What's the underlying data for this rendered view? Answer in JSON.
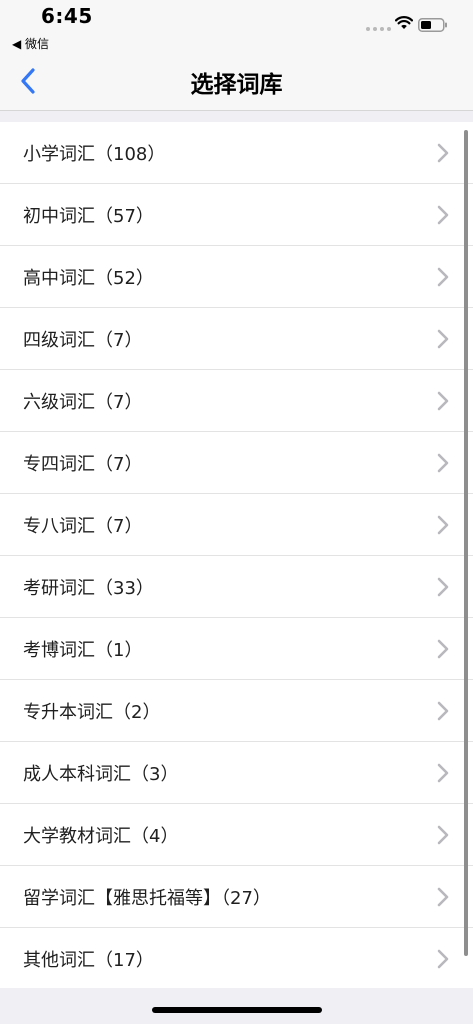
{
  "status_bar": {
    "time": "6:45",
    "back_app": "◀ 微信"
  },
  "nav": {
    "back_icon": "chevron-left-icon",
    "title": "选择词库",
    "accent_color": "#3478f6"
  },
  "list": {
    "items": [
      {
        "label": "小学词汇（108）"
      },
      {
        "label": "初中词汇（57）"
      },
      {
        "label": "高中词汇（52）"
      },
      {
        "label": "四级词汇（7）"
      },
      {
        "label": "六级词汇（7）"
      },
      {
        "label": "专四词汇（7）"
      },
      {
        "label": "专八词汇（7）"
      },
      {
        "label": "考研词汇（33）"
      },
      {
        "label": "考博词汇（1）"
      },
      {
        "label": "专升本词汇（2）"
      },
      {
        "label": "成人本科词汇（3）"
      },
      {
        "label": "大学教材词汇（4）"
      },
      {
        "label": "留学词汇【雅思托福等】（27）"
      },
      {
        "label": "其他词汇（17）"
      }
    ],
    "chevron_icon": "chevron-right-icon"
  }
}
